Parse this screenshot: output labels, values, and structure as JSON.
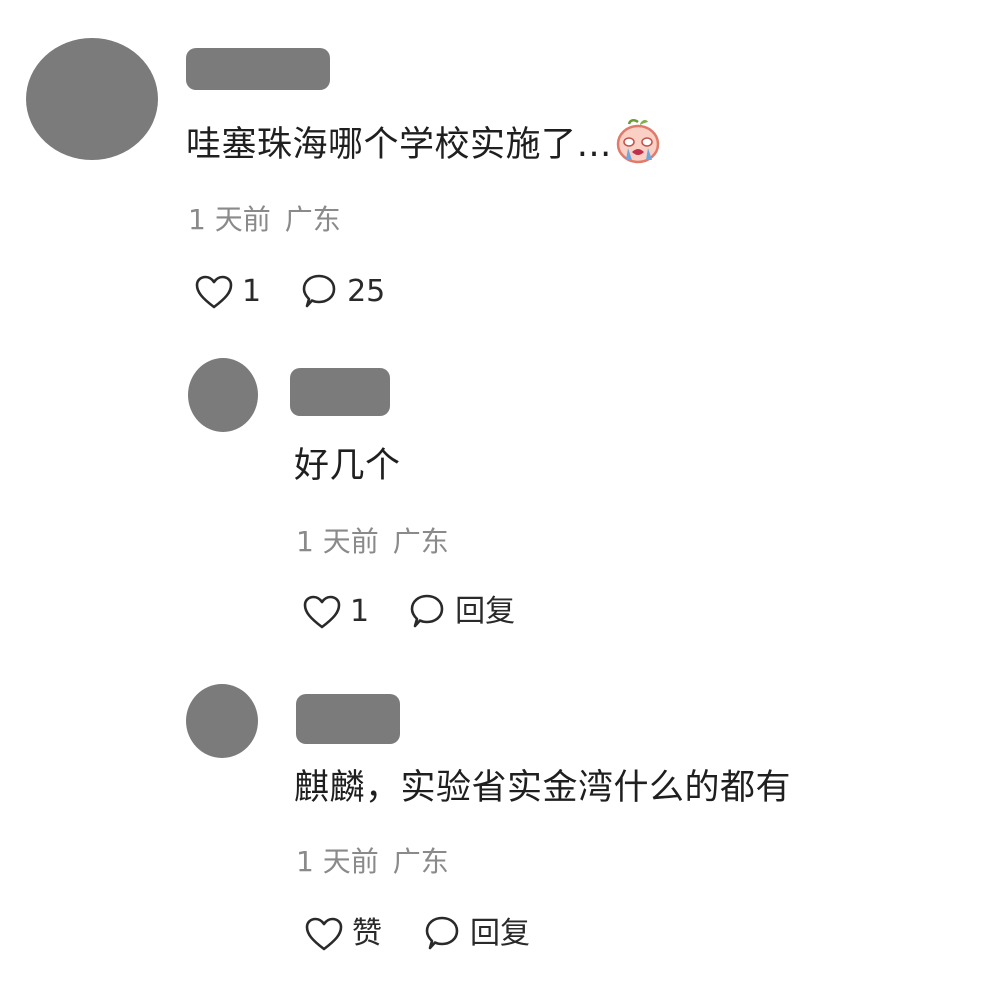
{
  "comments": [
    {
      "text": "哇塞珠海哪个学校实施了…",
      "time": "1 天前",
      "location": "广东",
      "like_count": "1",
      "reply_label": "25",
      "emoji": "crying-emoji"
    },
    {
      "text": "好几个",
      "time": "1 天前",
      "location": "广东",
      "like_count": "1",
      "reply_label": "回复"
    },
    {
      "text": "麒麟，实验省实金湾什么的都有",
      "time": "1 天前",
      "location": "广东",
      "like_count": "赞",
      "reply_label": "回复"
    }
  ],
  "icons": {
    "like": "heart-outline-icon",
    "reply": "speech-bubble-icon"
  },
  "colors": {
    "redacted_gray": "#7b7b7b",
    "meta_gray": "#8a8a8a",
    "text": "#1f1f1f"
  }
}
